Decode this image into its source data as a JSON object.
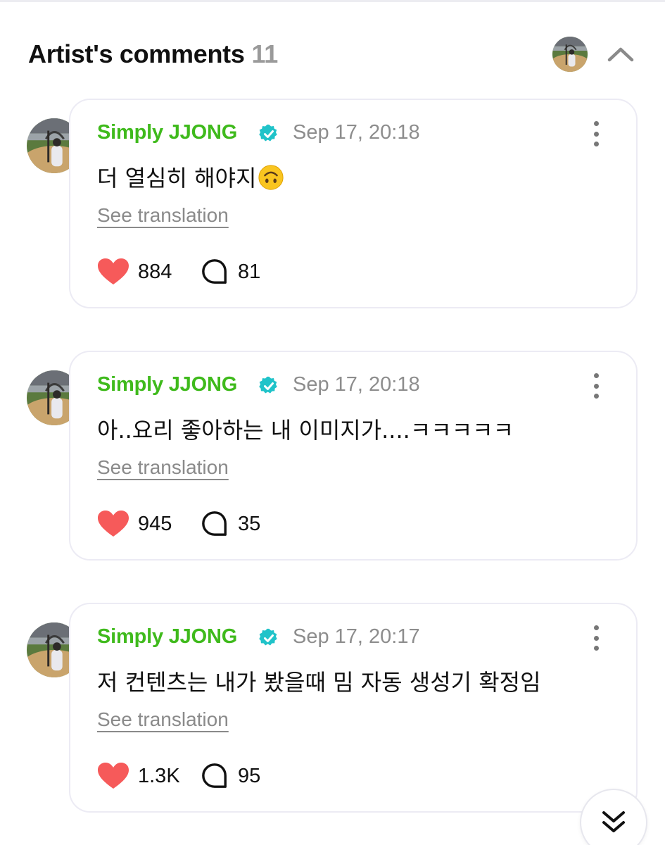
{
  "header": {
    "title": "Artist's comments",
    "count": "11",
    "icons": {
      "avatar": "profile-avatar",
      "collapse": "chevron-up-icon"
    }
  },
  "colors": {
    "author_green": "#3fba1c",
    "verified_teal": "#20c3c9",
    "heart_red": "#f65a5a",
    "muted_gray": "#8d8d8d"
  },
  "comments": [
    {
      "author": "Simply JJONG",
      "timestamp": "Sep 17, 20:18",
      "text": "더 열심히 해야지",
      "emoji": "upside-down-face",
      "translate_label": "See translation",
      "likes": "884",
      "replies": "81"
    },
    {
      "author": "Simply JJONG",
      "timestamp": "Sep 17, 20:18",
      "text": "아..요리 좋아하는 내 이미지가....ㅋㅋㅋㅋㅋ",
      "translate_label": "See translation",
      "likes": "945",
      "replies": "35"
    },
    {
      "author": "Simply JJONG",
      "timestamp": "Sep 17, 20:17",
      "text": "저 컨텐츠는 내가 봤을때 밈 자동 생성기 확정임",
      "translate_label": "See translation",
      "likes": "1.3K",
      "replies": "95"
    }
  ],
  "scroll_button": {
    "icon": "double-chevron-down-icon"
  }
}
